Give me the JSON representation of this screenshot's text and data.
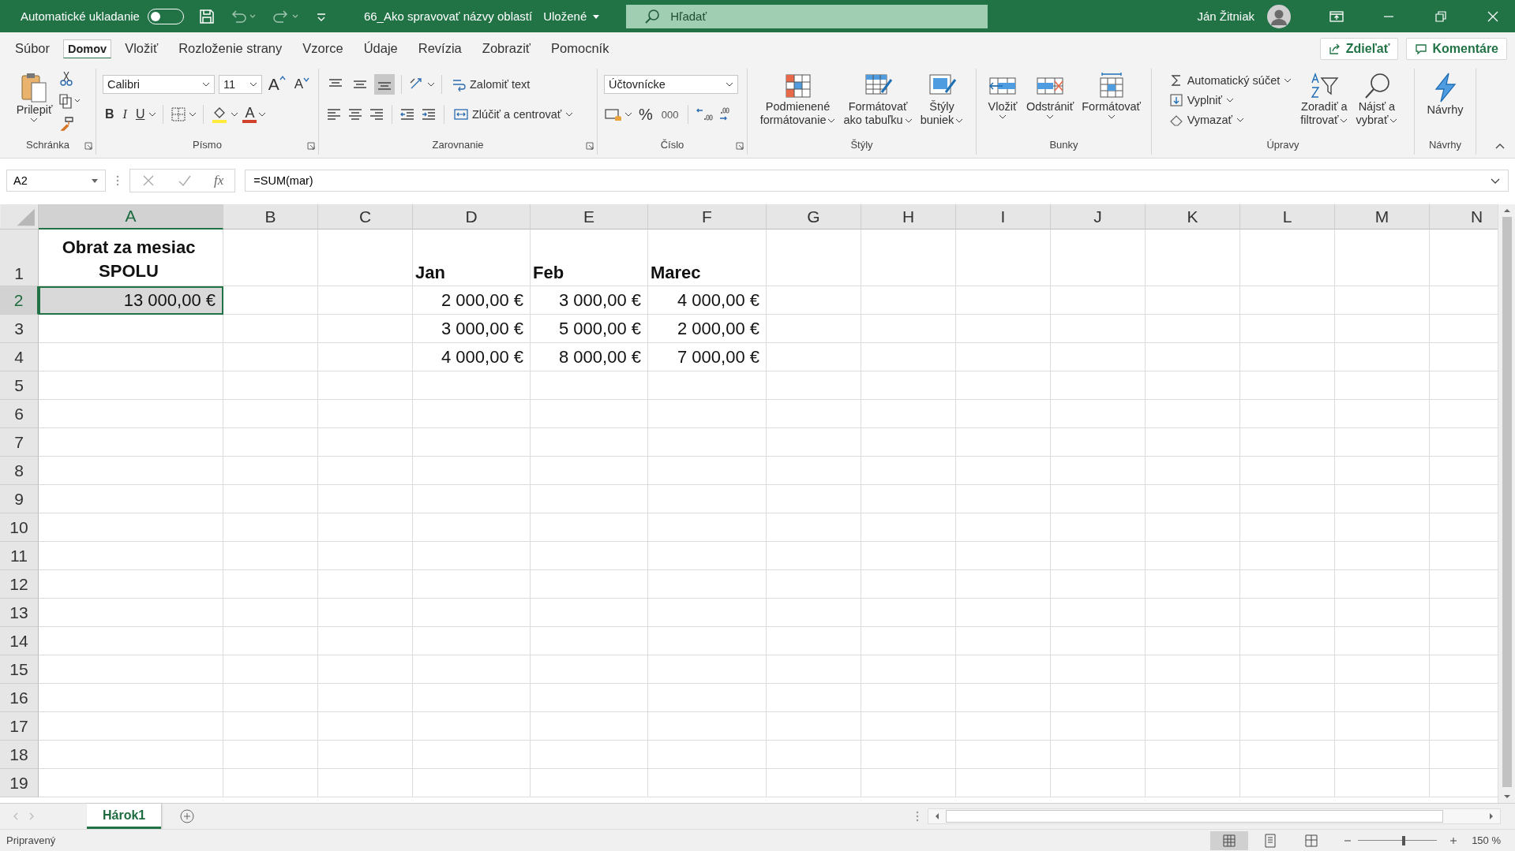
{
  "title_bar": {
    "autosave": {
      "label": "Automatické ukladanie",
      "on": false
    },
    "document_title": "66_Ako spravovať názvy oblastí",
    "save_state": "Uložené",
    "search": {
      "placeholder": "Hľadať"
    },
    "user": "Ján Žitniak"
  },
  "menu_tabs": [
    {
      "label": "Súbor",
      "selected": false
    },
    {
      "label": "Domov",
      "selected": true
    },
    {
      "label": "Vložiť",
      "selected": false
    },
    {
      "label": "Rozloženie strany",
      "selected": false
    },
    {
      "label": "Vzorce",
      "selected": false
    },
    {
      "label": "Údaje",
      "selected": false
    },
    {
      "label": "Revízia",
      "selected": false
    },
    {
      "label": "Zobraziť",
      "selected": false
    },
    {
      "label": "Pomocník",
      "selected": false
    }
  ],
  "share_button": "Zdieľať",
  "comments_button": "Komentáre",
  "ribbon": {
    "clipboard": {
      "label": "Schránka",
      "paste": "Prilepiť"
    },
    "font": {
      "label": "Písmo",
      "font_name": "Calibri",
      "font_size": "11",
      "grow": "A",
      "shrink": "A",
      "bold": "B",
      "italic": "I",
      "underline": "U",
      "font_color": "A"
    },
    "alignment": {
      "label": "Zarovnanie",
      "vertical_align": [
        {
          "selected": false
        },
        {
          "selected": false
        },
        {
          "selected": true
        }
      ],
      "wrap_text": "Zalomiť text",
      "merge": "Zlúčiť a centrovať"
    },
    "number": {
      "label": "Číslo",
      "format": "Účtovnícke",
      "percent": "%",
      "thousands": "000"
    },
    "styles": {
      "label": "Štýly",
      "buttons": [
        {
          "kind": "conditional",
          "lines": [
            "Podmienené",
            "formátovanie"
          ]
        },
        {
          "kind": "table",
          "lines": [
            "Formátovať",
            "ako tabuľku"
          ]
        },
        {
          "kind": "cellstyles",
          "lines": [
            "Štýly",
            "buniek"
          ]
        }
      ]
    },
    "cells": {
      "label": "Bunky",
      "buttons": [
        {
          "kind": "insert",
          "lines": [
            "Vložiť"
          ]
        },
        {
          "kind": "delete",
          "lines": [
            "Odstrániť"
          ]
        },
        {
          "kind": "format",
          "lines": [
            "Formátovať"
          ]
        }
      ]
    },
    "editing": {
      "label": "Úpravy",
      "autosum": "Automatický súčet",
      "fill": "Vyplniť",
      "clear": "Vymazať",
      "sort": [
        "Zoradiť a",
        "filtrovať"
      ],
      "find": [
        "Nájsť a",
        "vybrať"
      ]
    },
    "ideas": {
      "label": "Návrhy",
      "button": "Návrhy"
    }
  },
  "formula_bar": {
    "name_box": "A2",
    "function_label": "fx",
    "formula": "=SUM(mar)"
  },
  "sheet": {
    "columns": [
      {
        "label": "A",
        "selected": true
      },
      {
        "label": "B",
        "selected": false
      },
      {
        "label": "C",
        "selected": false
      },
      {
        "label": "D",
        "selected": false
      },
      {
        "label": "E",
        "selected": false
      },
      {
        "label": "F",
        "selected": false
      },
      {
        "label": "G",
        "selected": false
      },
      {
        "label": "H",
        "selected": false
      },
      {
        "label": "I",
        "selected": false
      },
      {
        "label": "J",
        "selected": false
      },
      {
        "label": "K",
        "selected": false
      },
      {
        "label": "L",
        "selected": false
      },
      {
        "label": "M",
        "selected": false
      },
      {
        "label": "N",
        "selected": false
      }
    ],
    "rows": [
      {
        "number": "1",
        "selected": false,
        "bold": true,
        "cells": [
          "Obrat za mesiac SPOLU",
          null,
          null,
          "Jan",
          "Feb",
          "Marec"
        ]
      },
      {
        "number": "2",
        "selected": true,
        "bold": false,
        "cells": [
          "13 000,00 €",
          null,
          null,
          "2 000,00 €",
          "3 000,00 €",
          "4 000,00 €"
        ]
      },
      {
        "number": "3",
        "selected": false,
        "bold": false,
        "cells": [
          null,
          null,
          null,
          "3 000,00 €",
          "5 000,00 €",
          "2 000,00 €"
        ]
      },
      {
        "number": "4",
        "selected": false,
        "bold": false,
        "cells": [
          null,
          null,
          null,
          "4 000,00 €",
          "8 000,00 €",
          "7 000,00 €"
        ]
      },
      {
        "number": "5",
        "selected": false
      },
      {
        "number": "6",
        "selected": false
      },
      {
        "number": "7",
        "selected": false
      },
      {
        "number": "8",
        "selected": false
      },
      {
        "number": "9",
        "selected": false
      },
      {
        "number": "10",
        "selected": false
      },
      {
        "number": "11",
        "selected": false
      },
      {
        "number": "12",
        "selected": false
      },
      {
        "number": "13",
        "selected": false
      },
      {
        "number": "14",
        "selected": false
      },
      {
        "number": "15",
        "selected": false
      },
      {
        "number": "16",
        "selected": false
      },
      {
        "number": "17",
        "selected": false
      },
      {
        "number": "18",
        "selected": false
      },
      {
        "number": "19",
        "selected": false
      }
    ]
  },
  "sheet_tabs": [
    {
      "label": "Hárok1",
      "selected": true
    }
  ],
  "status_bar": {
    "status": "Pripravený",
    "zoom": {
      "level": 0.58,
      "reading": "150 %"
    }
  }
}
